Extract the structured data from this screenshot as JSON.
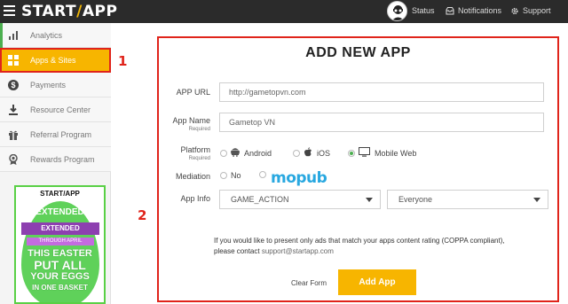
{
  "header": {
    "logo_text": "START",
    "logo_text_end": "APP",
    "status_label": "Status",
    "notifications_label": "Notifications",
    "support_label": "Support"
  },
  "sidebar": {
    "items": [
      {
        "label": "Analytics",
        "icon": "bar-chart-icon"
      },
      {
        "label": "Apps & Sites",
        "icon": "grid-icon",
        "active": true
      },
      {
        "label": "Payments",
        "icon": "dollar-icon"
      },
      {
        "label": "Resource Center",
        "icon": "download-icon"
      },
      {
        "label": "Referral Program",
        "icon": "gift-icon"
      },
      {
        "label": "Rewards Program",
        "icon": "award-icon"
      }
    ]
  },
  "ad": {
    "logo": "START/APP",
    "line1": "EXTENDED",
    "line2": "THROUGH APRIL",
    "line3": "THIS EASTER",
    "line4": "PUT ALL",
    "line5": "YOUR EGGS",
    "line6": "IN ONE BASKET"
  },
  "annotations": {
    "one": "1",
    "two": "2"
  },
  "form": {
    "title": "ADD NEW APP",
    "app_url_label": "APP URL",
    "app_url_value": "http://gametopvn.com",
    "app_name_label": "App Name",
    "required_label": "Required",
    "app_name_value": "Gametop VN",
    "platform_label": "Platform",
    "platform_options": [
      "Android",
      "iOS",
      "Mobile Web"
    ],
    "platform_selected": "Mobile Web",
    "mediation_label": "Mediation",
    "mediation_no": "No",
    "mediation_brand": "mopub",
    "app_info_label": "App Info",
    "category_value": "GAME_ACTION",
    "rating_value": "Everyone",
    "note_line1": "If you would like to present only ads that match your apps content rating (COPPA compliant),",
    "note_line2_prefix": "please contact ",
    "note_email": "support@startapp.com",
    "clear_label": "Clear Form",
    "add_label": "Add App"
  },
  "colors": {
    "accent": "#f7b500",
    "annotation": "#e0241b",
    "topbar": "#2b2b2b",
    "mopub": "#29a8e0"
  }
}
